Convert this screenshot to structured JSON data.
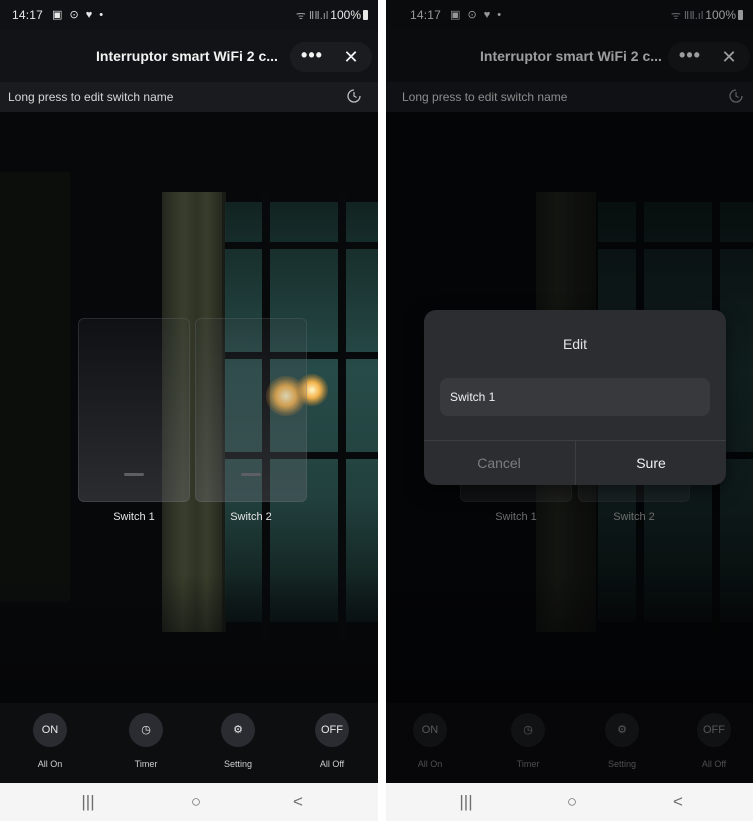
{
  "status_bar": {
    "time": "14:17",
    "left_icons": "▣ ⊙ ♥ •",
    "signal": "ᯤ ⅡⅡ.ıl",
    "battery": "100%"
  },
  "header": {
    "title": "Interruptor smart WiFi 2 c...",
    "more": "•••",
    "close": "✕"
  },
  "hint": {
    "text": "Long press to edit switch name"
  },
  "switches": [
    {
      "label": "Switch 1"
    },
    {
      "label": "Switch 2"
    }
  ],
  "toolbar": [
    {
      "icon": "ON",
      "label": "All On"
    },
    {
      "icon": "◷",
      "label": "Timer"
    },
    {
      "icon": "⚙",
      "label": "Setting"
    },
    {
      "icon": "OFF",
      "label": "All Off"
    }
  ],
  "nav": {
    "recent": "|||",
    "home": "○",
    "back": "<"
  },
  "dialog": {
    "title": "Edit",
    "input_value": "Switch 1",
    "cancel": "Cancel",
    "sure": "Sure"
  },
  "colors": {
    "background": "#0a0b0d",
    "dialog_bg": "#2b2d30",
    "accent_text": "#f0f0f0",
    "muted_text": "#7b7d82"
  }
}
